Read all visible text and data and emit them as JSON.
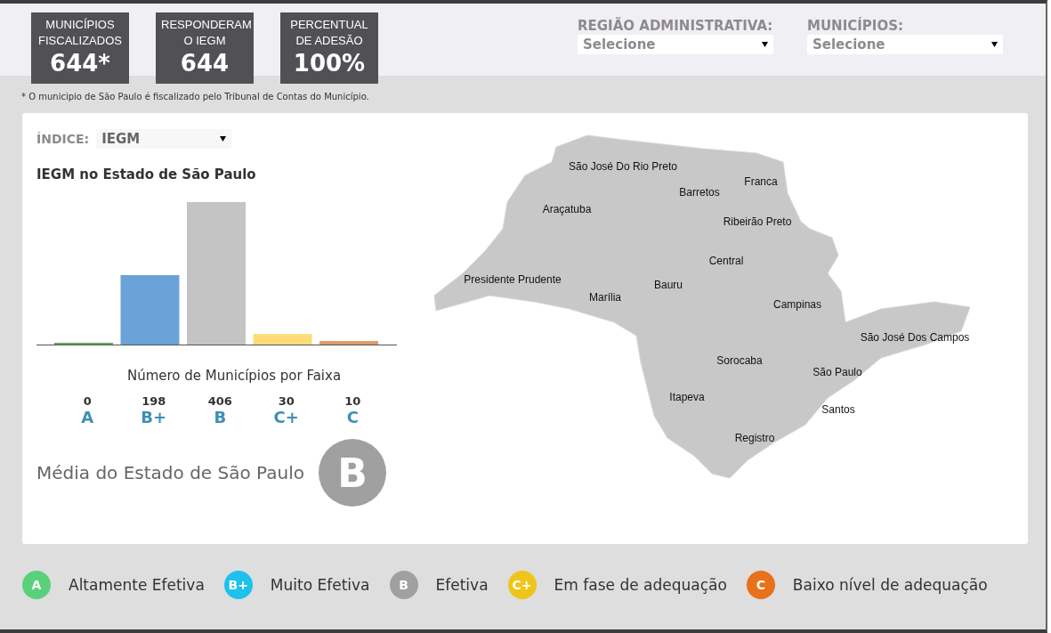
{
  "stats": [
    {
      "label": "MUNICÍPIOS FISCALIZADOS",
      "value": "644*"
    },
    {
      "label": "RESPONDERAM O IEGM",
      "value": "644"
    },
    {
      "label": "PERCENTUAL DE ADESÃO",
      "value": "100%"
    }
  ],
  "footnote": "* O municipio de São Paulo é fiscalizado pelo Tribunal de Contas do Município.",
  "filters": [
    {
      "label": "REGIÃO ADMINISTRATIVA:",
      "placeholder": "Selecione"
    },
    {
      "label": "MUNICÍPIOS:",
      "placeholder": "Selecione"
    }
  ],
  "index_filter": {
    "label": "ÍNDICE:",
    "value": "IEGM"
  },
  "chart_title": "IEGM no Estado de São Paulo",
  "chart_data": {
    "type": "bar",
    "xlabel": "Número de Municípios por Faixa",
    "categories": [
      "A",
      "B+",
      "B",
      "C+",
      "C"
    ],
    "colors": [
      "#6aa84f",
      "#6aa3d8",
      "#c4c4c4",
      "#fcdc78",
      "#e39a6a"
    ],
    "series": [
      {
        "values": [
          0,
          198,
          406,
          30,
          10
        ]
      }
    ],
    "data_labels": true
  },
  "average": {
    "label": "Média do Estado de São Paulo",
    "grade": "B"
  },
  "map_regions": [
    "São José Do Rio Preto",
    "Franca",
    "Barretos",
    "Araçatuba",
    "Ribeirão Preto",
    "Central",
    "Presidente Prudente",
    "Bauru",
    "Marília",
    "Campinas",
    "São José Dos Campos",
    "Sorocaba",
    "São Paulo",
    "Itapeva",
    "Santos",
    "Registro"
  ],
  "legend": [
    {
      "grade": "A",
      "label": "Altamente Efetiva",
      "color": "#5bd07a"
    },
    {
      "grade": "B+",
      "label": "Muito Efetiva",
      "color": "#1ec0ec"
    },
    {
      "grade": "B",
      "label": "Efetiva",
      "color": "#a0a0a0"
    },
    {
      "grade": "C+",
      "label": "Em fase de adequação",
      "color": "#f0c419"
    },
    {
      "grade": "C",
      "label": "Baixo nível de adequação",
      "color": "#e8711a"
    }
  ]
}
